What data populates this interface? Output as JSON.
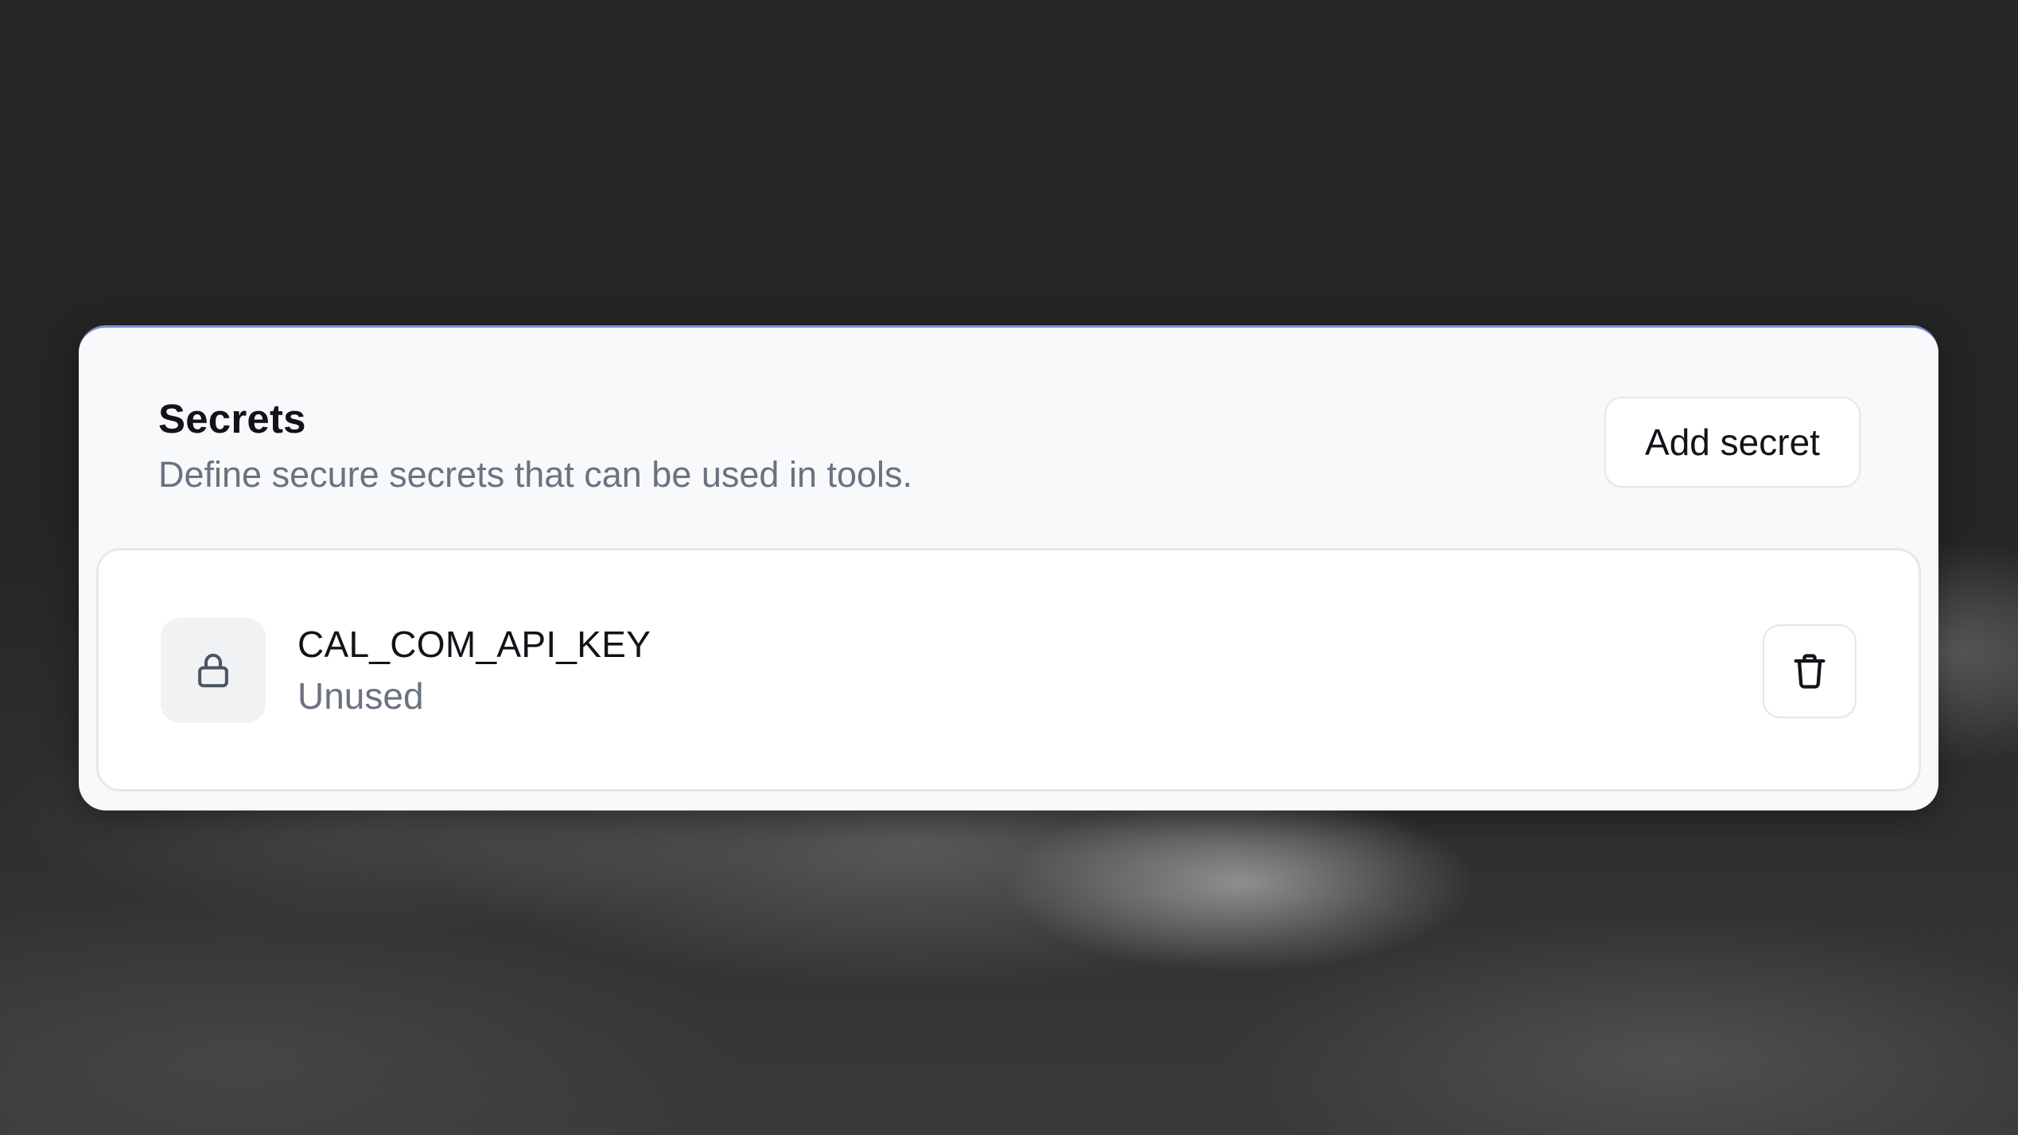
{
  "secrets_panel": {
    "title": "Secrets",
    "subtitle": "Define secure secrets that can be used in tools.",
    "add_button_label": "Add secret",
    "items": [
      {
        "name": "CAL_COM_API_KEY",
        "status": "Unused",
        "icon": "lock-icon",
        "delete_icon": "trash-icon"
      }
    ]
  },
  "colors": {
    "panel_background": "#f8f9fb",
    "card_background": "#ffffff",
    "title_text": "#111318",
    "muted_text": "#6b7280",
    "border": "#e4e6eb",
    "icon_tile": "#f1f2f4"
  }
}
